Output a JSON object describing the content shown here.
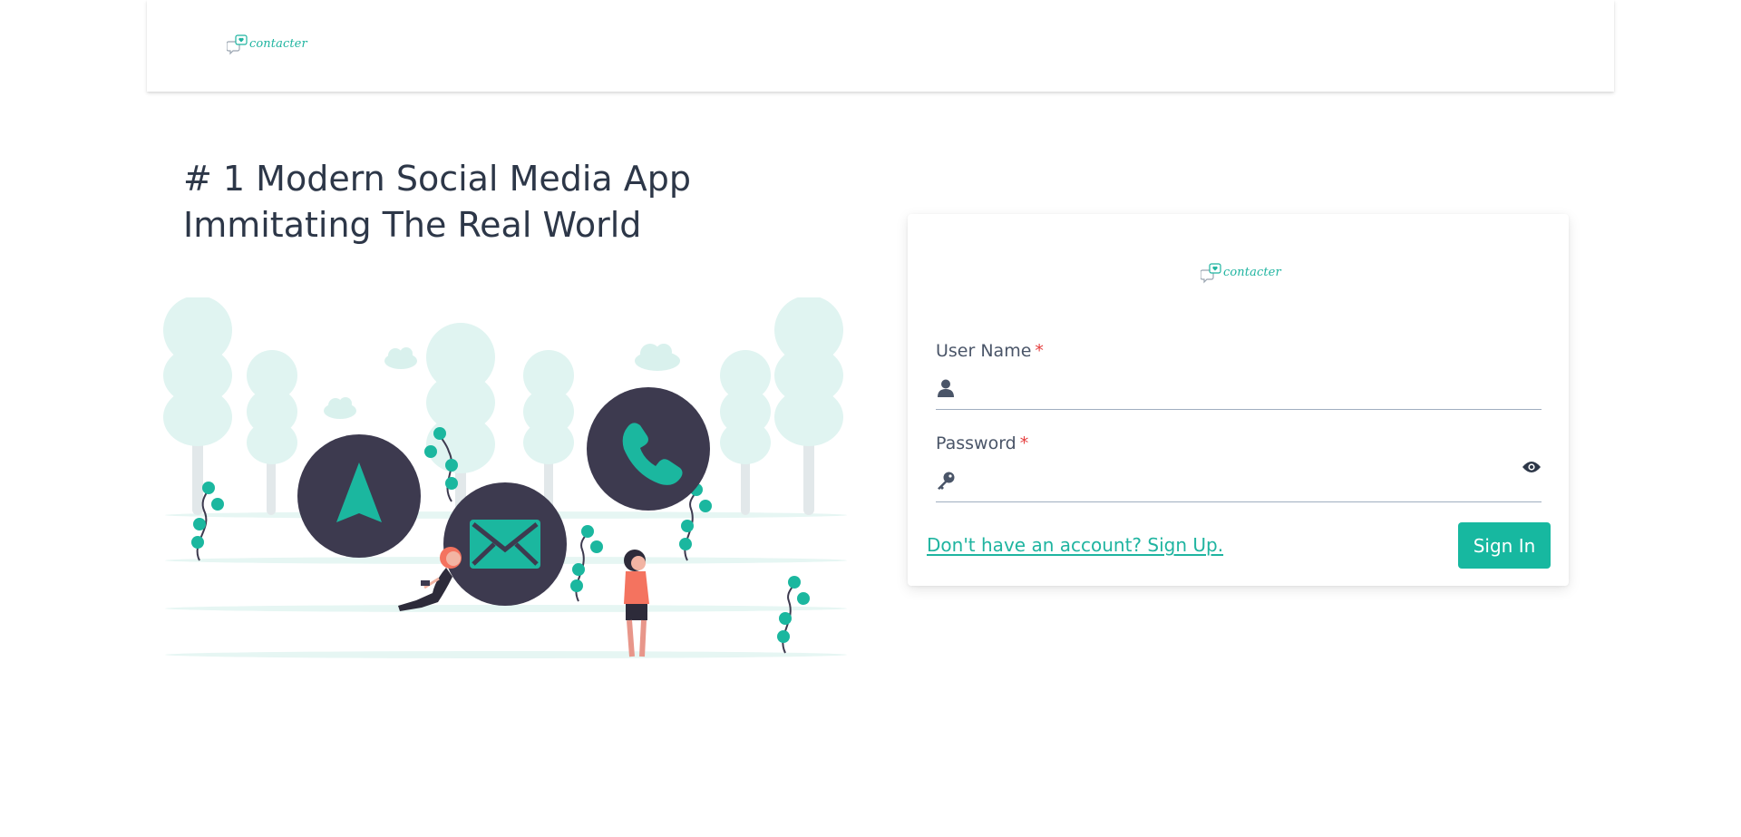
{
  "brand": {
    "name": "contacter",
    "accent": "#1fb4a0",
    "dark": "#3d3a4f",
    "coral": "#f4735f"
  },
  "hero": {
    "title": "# 1 Modern Social Media App Immitating The Real World"
  },
  "form": {
    "username": {
      "label": "User Name",
      "required_mark": "*",
      "value": "",
      "icon": "user-icon"
    },
    "password": {
      "label": "Password",
      "required_mark": "*",
      "value": "",
      "icon": "key-icon",
      "toggle_icon": "eye-icon"
    },
    "signup_link": "Don't have an account? Sign Up.",
    "submit_label": "Sign In"
  }
}
